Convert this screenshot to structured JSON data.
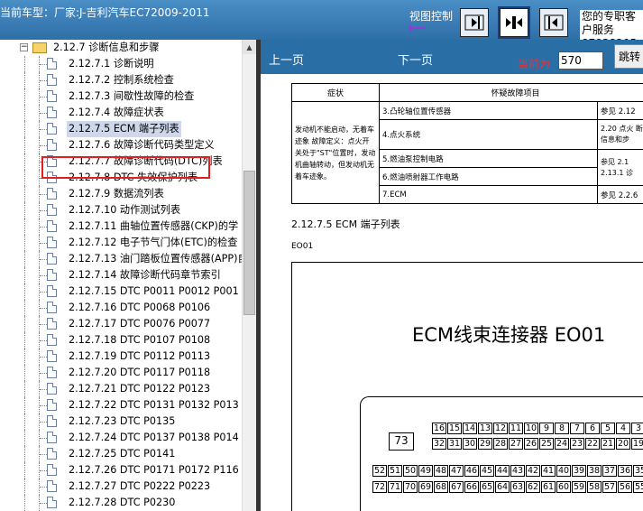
{
  "header": {
    "title": "当前车型：厂家:J-吉利汽车EC72009-2011",
    "view_control": "视图控制",
    "expert": "您的专职客户服务 87038205"
  },
  "tree": {
    "parent": "2.12.7 诊断信息和步骤",
    "items": [
      "2.12.7.1 诊断说明",
      "2.12.7.2 控制系统检查",
      "2.12.7.3 间歇性故障的检查",
      "2.12.7.4 故障症状表",
      "2.12.7.5 ECM 端子列表",
      "2.12.7.6 故障诊断代码类型定义",
      "2.12.7.7 故障诊断代码(DTC)列表",
      "2.12.7.8 DTC 失效保护列表",
      "2.12.7.9 数据流列表",
      "2.12.7.10 动作测试列表",
      "2.12.7.11 曲轴位置传感器(CKP)的学",
      "2.12.7.12 电子节气门体(ETC)的检查",
      "2.12.7.13 油门踏板位置传感器(APP)自",
      "2.12.7.14 故障诊断代码章节索引",
      "2.12.7.15 DTC P0011 P0012 P001",
      "2.12.7.16 DTC P0068 P0106",
      "2.12.7.17 DTC P0076 P0077",
      "2.12.7.18 DTC P0107 P0108",
      "2.12.7.19 DTC P0112 P0113",
      "2.12.7.20 DTC P0117 P0118",
      "2.12.7.21 DTC P0122 P0123",
      "2.12.7.22 DTC P0131 P0132 P013",
      "2.12.7.23 DTC P0135",
      "2.12.7.24 DTC P0137 P0138 P014",
      "2.12.7.25 DTC P0141",
      "2.12.7.26 DTC P0171 P0172 P116",
      "2.12.7.27 DTC P0222 P0223",
      "2.12.7.28 DTC P0230"
    ]
  },
  "docnav": {
    "prev": "上一页",
    "next": "下一页",
    "current_label": "当前为",
    "page": "570",
    "jump": "跳转"
  },
  "doc": {
    "table": {
      "h_symptom": "症状",
      "h_item": "怀疑故障项目",
      "symptom": "发动机不能启动，无着车迹象 故障定义：点火开关处于\"ST\"位置时，发动机曲轴转动，但发动机无着车迹象。",
      "rows": [
        {
          "item": "3.凸轮轴位置传感器",
          "ref": "参见 2.12"
        },
        {
          "item": "4.点火系统",
          "ref": "2.20 点火 断信息和步"
        },
        {
          "item": "5.燃油泵控制电路",
          "ref": "参见 2.1 2.13.1 诊"
        },
        {
          "item": "6.燃油喷射器工作电路",
          "ref": ""
        },
        {
          "item": "7.ECM",
          "ref": "参见 2.2.6"
        }
      ]
    },
    "section_title": "2.12.7.5 ECM 端子列表",
    "connector_id": "EO01",
    "connector_title": "ECM线束连接器  EO01",
    "pin_big": "73",
    "pins_row1": [
      "16",
      "15",
      "14",
      "13",
      "12",
      "11",
      "10",
      "9",
      "8",
      "7",
      "6",
      "5",
      "4",
      "3"
    ],
    "pins_row2": [
      "32",
      "31",
      "30",
      "29",
      "28",
      "27",
      "26",
      "25",
      "24",
      "23",
      "22",
      "21",
      "20",
      "19"
    ],
    "pins_row3": [
      "52",
      "51",
      "50",
      "49",
      "48",
      "47",
      "46",
      "45",
      "44",
      "43",
      "42",
      "41",
      "40",
      "39",
      "38",
      "37",
      "36",
      "35"
    ],
    "pins_row4": [
      "72",
      "71",
      "70",
      "69",
      "68",
      "67",
      "66",
      "65",
      "64",
      "63",
      "62",
      "61",
      "60",
      "59",
      "58",
      "57",
      "56",
      "55"
    ]
  }
}
